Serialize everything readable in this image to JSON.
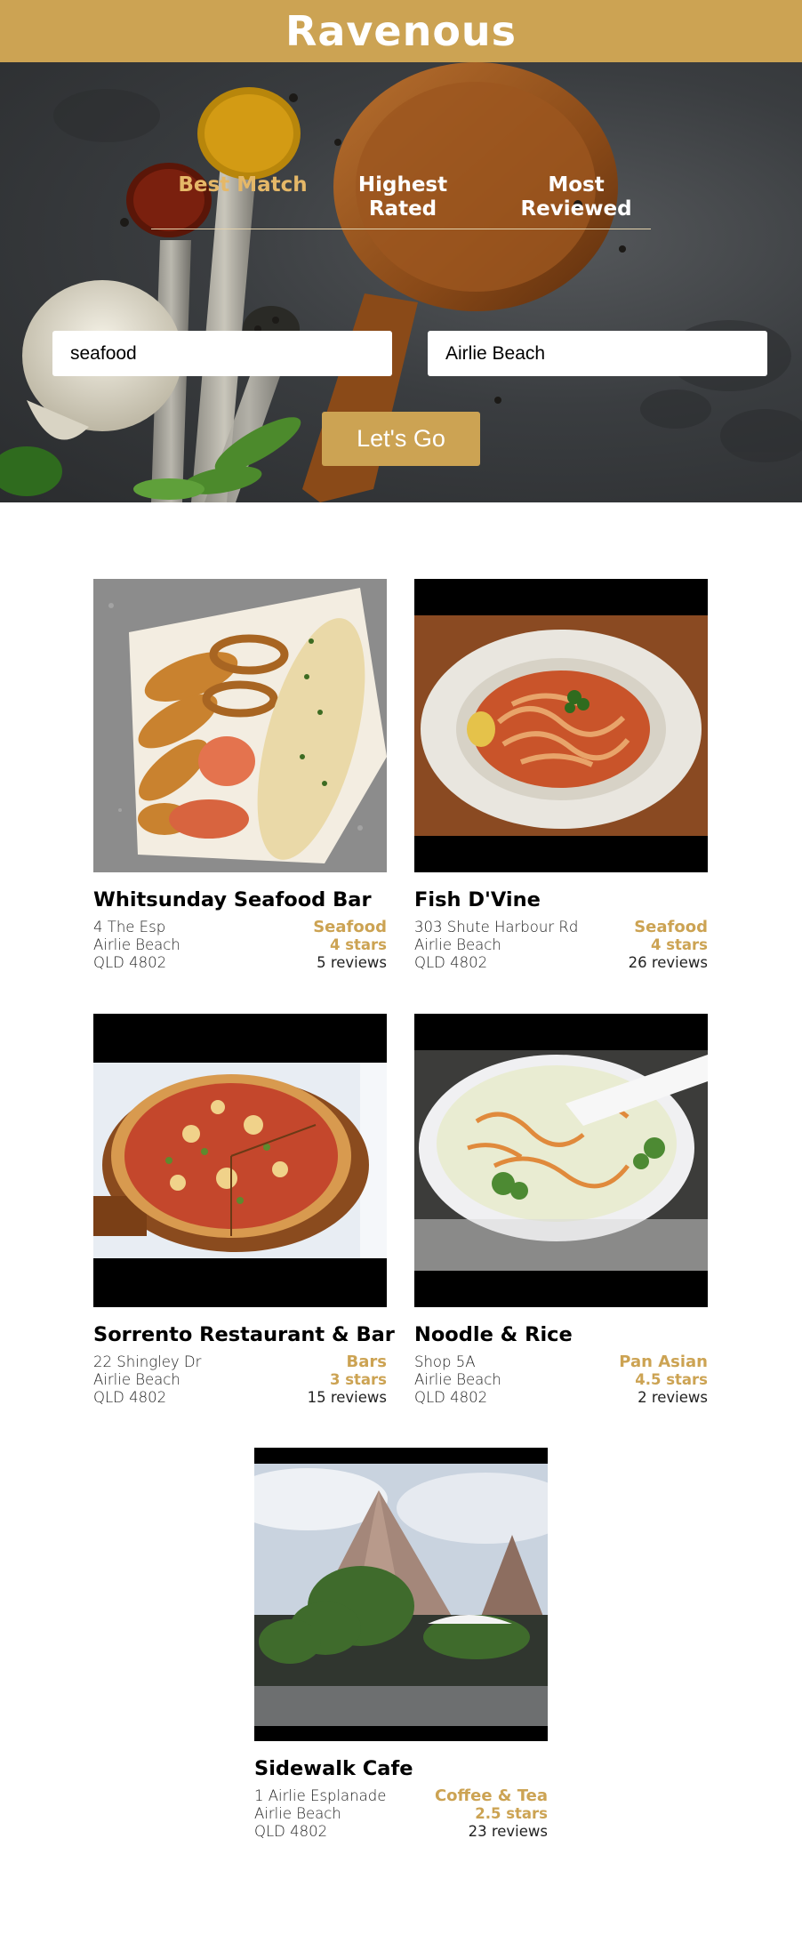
{
  "header": {
    "brand": "Ravenous"
  },
  "sort_options": [
    {
      "label": "Best Match",
      "active": true
    },
    {
      "label": "Highest Rated",
      "active": false
    },
    {
      "label": "Most Reviewed",
      "active": false
    }
  ],
  "search": {
    "term": "seafood",
    "location": "Airlie Beach",
    "button_label": "Let's Go"
  },
  "colors": {
    "accent": "#cca353",
    "active_tab": "#e5b868",
    "hero_bg": "#3a3d40"
  },
  "businesses": [
    {
      "name": "Whitsunday Seafood Bar",
      "address": "4 The Esp",
      "city": "Airlie Beach",
      "state_zip": "QLD 4802",
      "category": "Seafood",
      "rating": "4 stars",
      "reviews": "5 reviews",
      "photo": "fried seafood basket"
    },
    {
      "name": "Fish D'Vine",
      "address": "303 Shute Harbour Rd",
      "city": "Airlie Beach",
      "state_zip": "QLD 4802",
      "category": "Seafood",
      "rating": "4 stars",
      "reviews": "26 reviews",
      "photo": "seafood pasta plate"
    },
    {
      "name": "Sorrento Restaurant & Bar",
      "address": "22 Shingley Dr",
      "city": "Airlie Beach",
      "state_zip": "QLD 4802",
      "category": "Bars",
      "rating": "3 stars",
      "reviews": "15 reviews",
      "photo": "pizza on board"
    },
    {
      "name": "Noodle & Rice",
      "address": "Shop 5A",
      "city": "Airlie Beach",
      "state_zip": "QLD 4802",
      "category": "Pan Asian",
      "rating": "4.5 stars",
      "reviews": "2 reviews",
      "photo": "creamy noodle bowl"
    },
    {
      "name": "Sidewalk Cafe",
      "address": "1 Airlie Esplanade",
      "city": "Airlie Beach",
      "state_zip": "QLD 4802",
      "category": "Coffee & Tea",
      "rating": "2.5 stars",
      "reviews": "23 reviews",
      "photo": "cafe exterior"
    }
  ]
}
